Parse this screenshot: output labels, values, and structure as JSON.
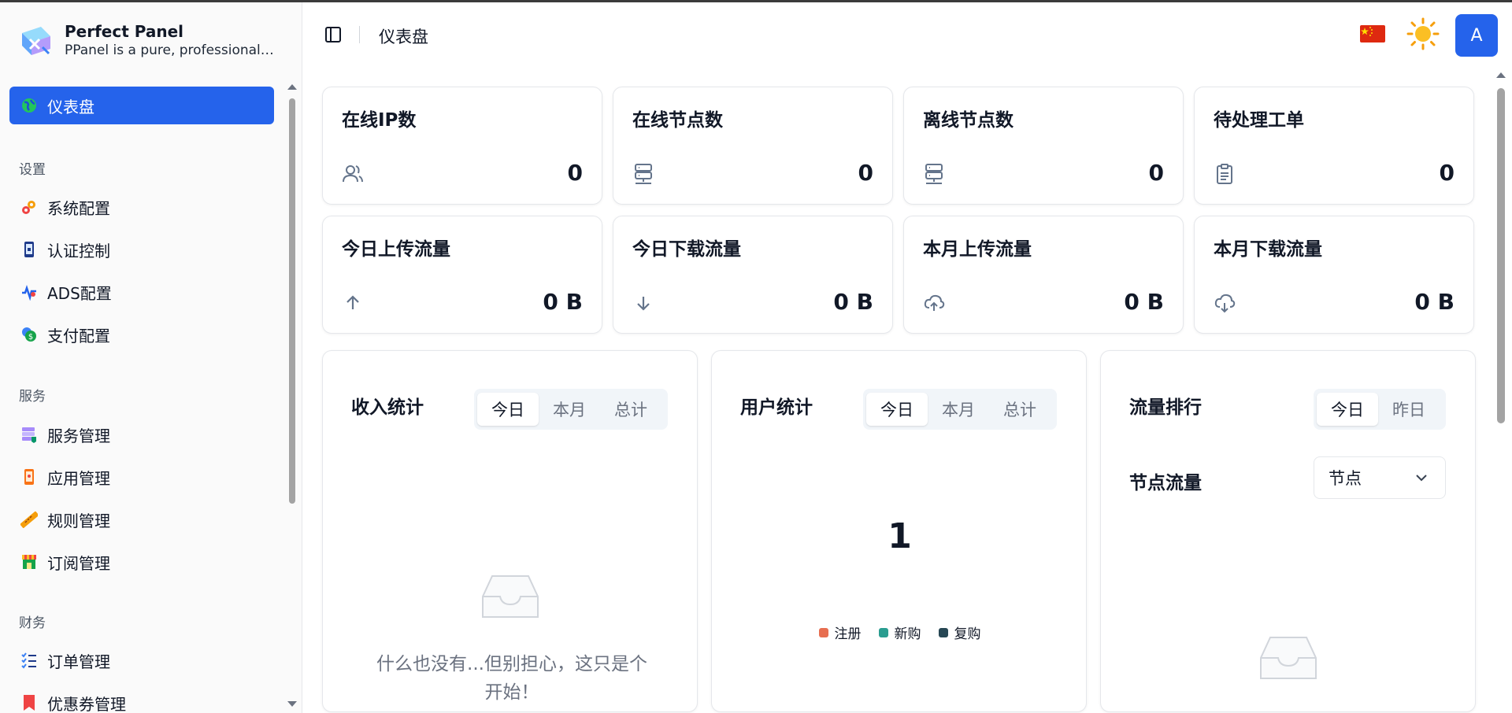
{
  "brand": {
    "title": "Perfect Panel",
    "subtitle": "PPanel is a pure, professional, a..."
  },
  "sidebar": {
    "active": {
      "label": "仪表盘",
      "icon": "globe-icon"
    },
    "groups": [
      {
        "title": "设置",
        "items": [
          {
            "label": "系统配置",
            "icon": "gears-icon"
          },
          {
            "label": "认证控制",
            "icon": "lock-phone-icon"
          },
          {
            "label": "ADS配置",
            "icon": "ads-icon"
          },
          {
            "label": "支付配置",
            "icon": "coin-icon"
          }
        ]
      },
      {
        "title": "服务",
        "items": [
          {
            "label": "服务管理",
            "icon": "server-stack-icon"
          },
          {
            "label": "应用管理",
            "icon": "mobile-app-icon"
          },
          {
            "label": "规则管理",
            "icon": "ruler-icon"
          },
          {
            "label": "订阅管理",
            "icon": "store-icon"
          }
        ]
      },
      {
        "title": "财务",
        "items": [
          {
            "label": "订单管理",
            "icon": "checklist-icon"
          },
          {
            "label": "优惠券管理",
            "icon": "bookmark-icon"
          }
        ]
      }
    ]
  },
  "header": {
    "title": "仪表盘",
    "avatar": "A",
    "language": "china-flag-icon",
    "theme": "sun-icon"
  },
  "stats": [
    {
      "title": "在线IP数",
      "value": "0",
      "icon": "users-icon"
    },
    {
      "title": "在线节点数",
      "value": "0",
      "icon": "server-icon"
    },
    {
      "title": "离线节点数",
      "value": "0",
      "icon": "server-icon"
    },
    {
      "title": "待处理工单",
      "value": "0",
      "icon": "clipboard-icon"
    },
    {
      "title": "今日上传流量",
      "value": "0 B",
      "icon": "arrow-up-icon"
    },
    {
      "title": "今日下载流量",
      "value": "0 B",
      "icon": "arrow-down-icon"
    },
    {
      "title": "本月上传流量",
      "value": "0 B",
      "icon": "cloud-upload-icon"
    },
    {
      "title": "本月下载流量",
      "value": "0 B",
      "icon": "cloud-download-icon"
    }
  ],
  "income": {
    "title": "收入统计",
    "tabs": [
      "今日",
      "本月",
      "总计"
    ],
    "selected": "今日",
    "empty_text": "什么也没有...但别担心，这只是个开始！"
  },
  "users": {
    "title": "用户统计",
    "tabs": [
      "今日",
      "本月",
      "总计"
    ],
    "selected": "今日",
    "total": "1",
    "legend": [
      {
        "label": "注册",
        "color": "#e76e50"
      },
      {
        "label": "新购",
        "color": "#2a9d90"
      },
      {
        "label": "复购",
        "color": "#274754"
      }
    ]
  },
  "traffic": {
    "title": "流量排行",
    "tabs": [
      "今日",
      "昨日"
    ],
    "selected": "今日",
    "sub_title": "节点流量",
    "select_value": "节点"
  },
  "colors": {
    "primary": "#2563eb",
    "muted": "#6b7280",
    "border": "#e5e7eb"
  }
}
